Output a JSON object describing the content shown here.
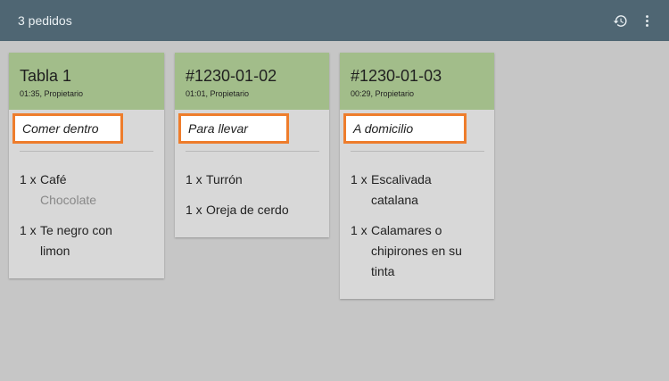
{
  "header": {
    "title": "3 pedidos",
    "icons": [
      "history-icon",
      "more-vert-icon"
    ]
  },
  "orders": [
    {
      "name": "Tabla 1",
      "meta": "01:35, Propietario",
      "type": "Comer dentro",
      "items": [
        {
          "qty": "1 x",
          "name": "Café",
          "modifier": "Chocolate"
        },
        {
          "qty": "1 x",
          "name": "Te negro con limon"
        }
      ]
    },
    {
      "name": "#1230-01-02",
      "meta": "01:01, Propietario",
      "type": "Para llevar",
      "items": [
        {
          "qty": "1 x",
          "name": "Turrón"
        },
        {
          "qty": "1 x",
          "name": "Oreja de cerdo"
        }
      ]
    },
    {
      "name": "#1230-01-03",
      "meta": "00:29, Propietario",
      "type": "A domicilio",
      "items": [
        {
          "qty": "1 x",
          "name": "Escalivada catalana"
        },
        {
          "qty": "1 x",
          "name": "Calamares o chipirones en su tinta"
        }
      ]
    }
  ],
  "colors": {
    "topbar": "#4f6673",
    "card_header": "#a2bd8a",
    "highlight": "#ee7d2c",
    "background": "#c6c6c6"
  }
}
